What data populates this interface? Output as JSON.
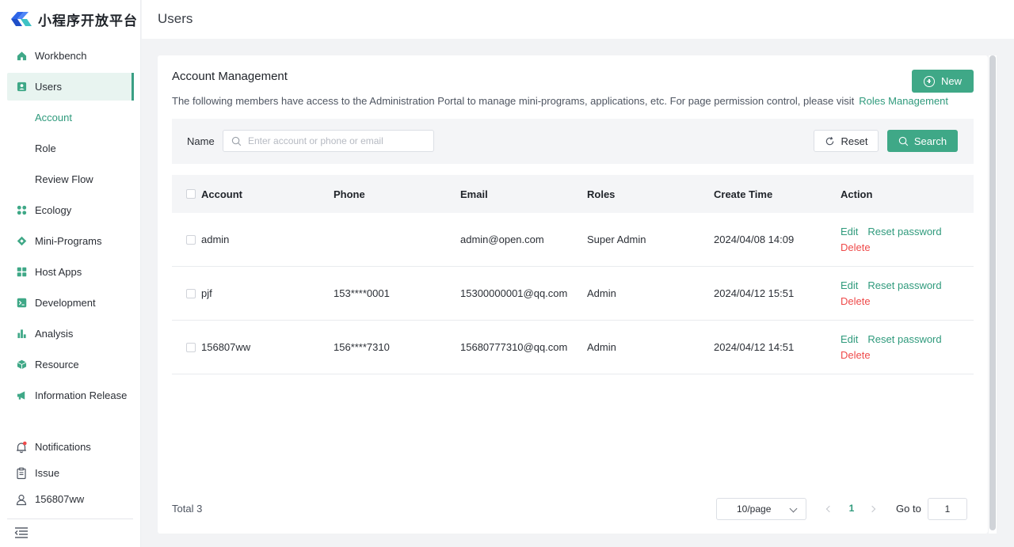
{
  "app": {
    "title": "小程序开放平台"
  },
  "colors": {
    "accent": "#3fa887",
    "danger": "#ef4a4a"
  },
  "sidebar": {
    "items": [
      {
        "label": "Workbench",
        "icon": "home-icon"
      },
      {
        "label": "Users",
        "icon": "user-icon",
        "active": true,
        "children": [
          {
            "label": "Account",
            "active": true
          },
          {
            "label": "Role"
          },
          {
            "label": "Review Flow"
          }
        ]
      },
      {
        "label": "Ecology",
        "icon": "ecology-icon"
      },
      {
        "label": "Mini-Programs",
        "icon": "diamond-icon"
      },
      {
        "label": "Host Apps",
        "icon": "apps-grid-icon"
      },
      {
        "label": "Development",
        "icon": "terminal-icon"
      },
      {
        "label": "Analysis",
        "icon": "bar-chart-icon"
      },
      {
        "label": "Resource",
        "icon": "cube-icon"
      },
      {
        "label": "Information Release",
        "icon": "megaphone-icon"
      }
    ],
    "bottom": [
      {
        "label": "Notifications",
        "icon": "bell-icon"
      },
      {
        "label": "Issue",
        "icon": "clipboard-icon"
      },
      {
        "label": "156807ww",
        "icon": "profile-icon"
      }
    ]
  },
  "header": {
    "title": "Users"
  },
  "card": {
    "title": "Account Management",
    "description": "The following members have access to the Administration Portal to manage mini-programs, applications, etc. For page permission control, please visit",
    "description_link": "Roles Management",
    "new_label": "New"
  },
  "filter": {
    "name_label": "Name",
    "search_placeholder": "Enter account or phone or email",
    "search_value": "",
    "reset_label": "Reset",
    "search_label": "Search"
  },
  "table": {
    "columns": [
      "Account",
      "Phone",
      "Email",
      "Roles",
      "Create Time",
      "Action"
    ],
    "rows": [
      {
        "account": "admin",
        "phone": "",
        "email": "admin@open.com",
        "roles": "Super Admin",
        "created": "2024/04/08 14:09"
      },
      {
        "account": "pjf",
        "phone": "153****0001",
        "email": "15300000001@qq.com",
        "roles": "Admin",
        "created": "2024/04/12 15:51"
      },
      {
        "account": "156807ww",
        "phone": "156****7310",
        "email": "15680777310@qq.com",
        "roles": "Admin",
        "created": "2024/04/12 14:51"
      }
    ],
    "actions": {
      "edit": "Edit",
      "reset_password": "Reset password",
      "delete": "Delete"
    }
  },
  "pagination": {
    "total": "Total 3",
    "page_size": "10/page",
    "current_page": "1",
    "goto_label": "Go to",
    "goto_value": "1"
  }
}
